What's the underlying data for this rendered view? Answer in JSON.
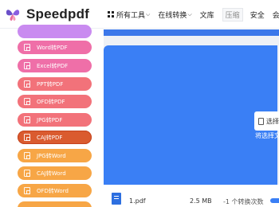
{
  "brand": {
    "name": "Speedpdf"
  },
  "nav": {
    "items": [
      {
        "label": "所有工具",
        "icon": "grid-icon",
        "dropdown": true
      },
      {
        "label": "在线转换",
        "dropdown": true
      },
      {
        "label": "文库"
      },
      {
        "label": "压缩"
      },
      {
        "label": "安全"
      },
      {
        "label": "会"
      }
    ]
  },
  "sidebar": {
    "items": [
      {
        "label": "",
        "color": "#c98bf0"
      },
      {
        "label": "Word转PDF",
        "color": "#ef6fa8"
      },
      {
        "label": "Excel转PDF",
        "color": "#ef6fa8"
      },
      {
        "label": "PPT转PDF",
        "color": "#f2727a"
      },
      {
        "label": "OFD转PDF",
        "color": "#f2727a"
      },
      {
        "label": "JPG转PDF",
        "color": "#f2727a"
      },
      {
        "label": "CAJ转PDF",
        "color": "#da5b2f"
      },
      {
        "label": "JPG转Word",
        "color": "#f7a646"
      },
      {
        "label": "CAJ转Word",
        "color": "#f7a646"
      },
      {
        "label": "OFD转Word",
        "color": "#f7a646"
      },
      {
        "label": "",
        "color": "#f7a646"
      }
    ]
  },
  "upload": {
    "select_label": "选择",
    "hint": "将选择文"
  },
  "file": {
    "name": "1.pdf",
    "size": "2.5 MB",
    "status": "-1 个转换次数"
  },
  "colors": {
    "accent": "#3a7ff5",
    "active_item": "#da5b2f"
  }
}
